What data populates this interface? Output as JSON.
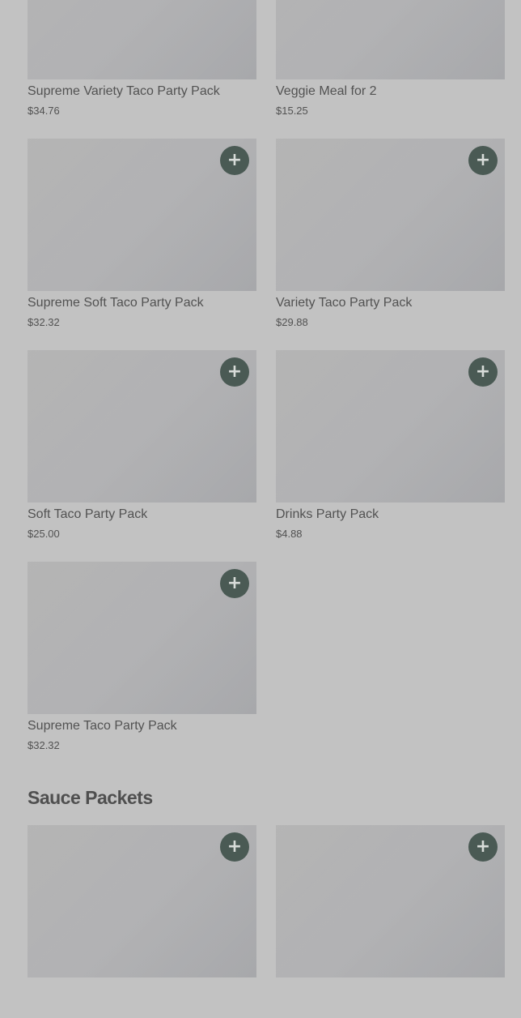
{
  "party_packs": {
    "items": [
      {
        "title": "Supreme Variety Taco Party Pack",
        "price": "$34.76"
      },
      {
        "title": "Veggie Meal for 2",
        "price": "$15.25"
      },
      {
        "title": "Supreme Soft Taco Party Pack",
        "price": "$32.32"
      },
      {
        "title": "Variety Taco Party Pack",
        "price": "$29.88"
      },
      {
        "title": "Soft Taco Party Pack",
        "price": "$25.00"
      },
      {
        "title": "Drinks Party Pack",
        "price": "$4.88"
      },
      {
        "title": "Supreme Taco Party Pack",
        "price": "$32.32"
      }
    ],
    "add_label": "+"
  },
  "sauce_packets": {
    "heading": "Sauce Packets"
  },
  "colors": {
    "overlay_background": "#c2c2c2",
    "add_button": "#4a5a54",
    "text": "#525252"
  },
  "icons": {
    "add": "plus-icon"
  }
}
